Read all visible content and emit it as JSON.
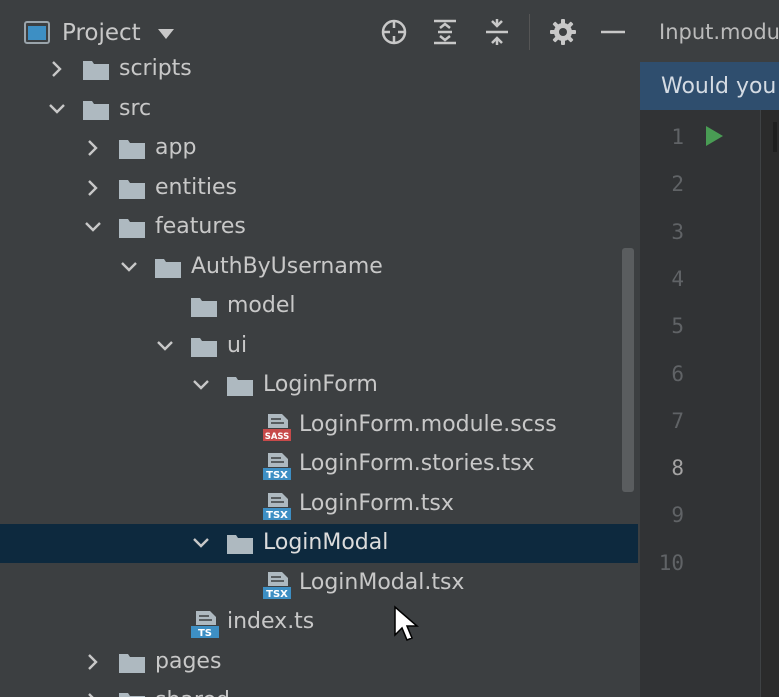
{
  "project_pane": {
    "title": "Project",
    "toolbar": [
      {
        "name": "locate-icon",
        "tooltip": ""
      },
      {
        "name": "expand-all-icon",
        "tooltip": ""
      },
      {
        "name": "collapse-all-icon",
        "tooltip": ""
      },
      {
        "name": "gear-icon",
        "tooltip": ""
      },
      {
        "name": "minimize-icon",
        "tooltip": ""
      }
    ],
    "tree": [
      {
        "label": "scripts",
        "kind": "folder",
        "depth": 0,
        "state": "collapsed"
      },
      {
        "label": "src",
        "kind": "folder",
        "depth": 0,
        "state": "expanded"
      },
      {
        "label": "app",
        "kind": "folder",
        "depth": 1,
        "state": "collapsed"
      },
      {
        "label": "entities",
        "kind": "folder",
        "depth": 1,
        "state": "collapsed"
      },
      {
        "label": "features",
        "kind": "folder",
        "depth": 1,
        "state": "expanded"
      },
      {
        "label": "AuthByUsername",
        "kind": "folder",
        "depth": 2,
        "state": "expanded"
      },
      {
        "label": "model",
        "kind": "folder",
        "depth": 3,
        "state": "none"
      },
      {
        "label": "ui",
        "kind": "folder",
        "depth": 3,
        "state": "expanded"
      },
      {
        "label": "LoginForm",
        "kind": "folder",
        "depth": 4,
        "state": "expanded"
      },
      {
        "label": "LoginForm.module.scss",
        "kind": "sass",
        "badge": "SASS",
        "depth": 5,
        "state": "none"
      },
      {
        "label": "LoginForm.stories.tsx",
        "kind": "tsx",
        "badge": "TSX",
        "depth": 5,
        "state": "none"
      },
      {
        "label": "LoginForm.tsx",
        "kind": "tsx",
        "badge": "TSX",
        "depth": 5,
        "state": "none"
      },
      {
        "label": "LoginModal",
        "kind": "folder",
        "depth": 4,
        "state": "expanded",
        "selected": true
      },
      {
        "label": "LoginModal.tsx",
        "kind": "tsx",
        "badge": "TSX",
        "depth": 5,
        "state": "none"
      },
      {
        "label": "index.ts",
        "kind": "ts",
        "badge": "TS",
        "depth": 3,
        "state": "none"
      },
      {
        "label": "pages",
        "kind": "folder",
        "depth": 1,
        "state": "collapsed"
      },
      {
        "label": "shared",
        "kind": "folder",
        "depth": 1,
        "state": "collapsed"
      }
    ]
  },
  "editor": {
    "tab_label": "Input.module.scss",
    "banner": "Would you like to install",
    "line_numbers": [
      "1",
      "2",
      "3",
      "4",
      "5",
      "6",
      "7",
      "8",
      "9",
      "10"
    ],
    "current_line": "8"
  },
  "colors": {
    "tree_bg": "#3c3f41",
    "selection": "#0d293e",
    "folder": "#aeb9c0",
    "sass_badge": "#c74a4a",
    "tsx_badge": "#3d8fc4",
    "run_green": "#499c54",
    "banner": "#2f4e6e"
  }
}
